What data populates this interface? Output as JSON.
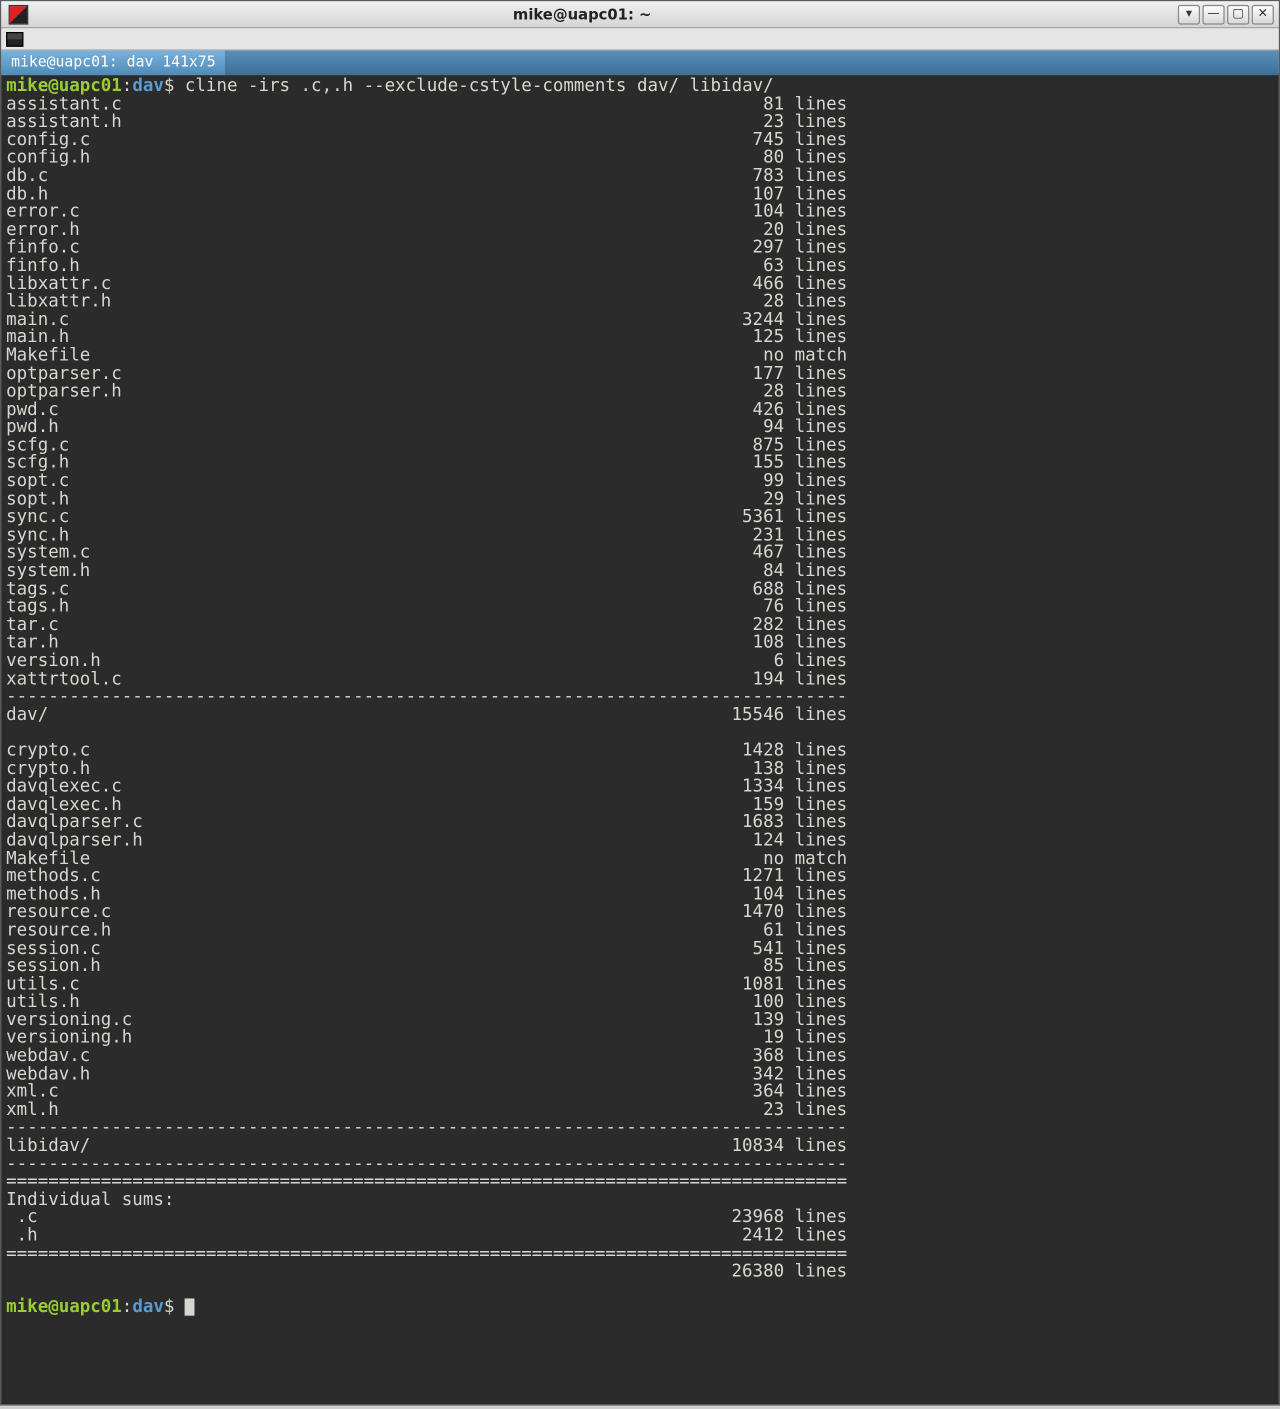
{
  "titlebar": {
    "title": "mike@uapc01: ~"
  },
  "wm": {
    "stick": "▾",
    "min": "—",
    "max": "▢",
    "close": "✕"
  },
  "tab": {
    "label": "mike@uapc01: dav 141x75"
  },
  "prompt": {
    "user": "mike@uapc01",
    "sep": ":",
    "path": "dav",
    "dollar": "$"
  },
  "command": "cline -irs .c,.h --exclude-cstyle-comments dav/ libidav/",
  "lines_word": "lines",
  "no_match": "no match",
  "group1": [
    {
      "name": "assistant.c",
      "val": "81"
    },
    {
      "name": "assistant.h",
      "val": "23"
    },
    {
      "name": "config.c",
      "val": "745"
    },
    {
      "name": "config.h",
      "val": "80"
    },
    {
      "name": "db.c",
      "val": "783"
    },
    {
      "name": "db.h",
      "val": "107"
    },
    {
      "name": "error.c",
      "val": "104"
    },
    {
      "name": "error.h",
      "val": "20"
    },
    {
      "name": "finfo.c",
      "val": "297"
    },
    {
      "name": "finfo.h",
      "val": "63"
    },
    {
      "name": "libxattr.c",
      "val": "466"
    },
    {
      "name": "libxattr.h",
      "val": "28"
    },
    {
      "name": "main.c",
      "val": "3244"
    },
    {
      "name": "main.h",
      "val": "125"
    },
    {
      "name": "Makefile",
      "val": "",
      "nomatch": true
    },
    {
      "name": "optparser.c",
      "val": "177"
    },
    {
      "name": "optparser.h",
      "val": "28"
    },
    {
      "name": "pwd.c",
      "val": "426"
    },
    {
      "name": "pwd.h",
      "val": "94"
    },
    {
      "name": "scfg.c",
      "val": "875"
    },
    {
      "name": "scfg.h",
      "val": "155"
    },
    {
      "name": "sopt.c",
      "val": "99"
    },
    {
      "name": "sopt.h",
      "val": "29"
    },
    {
      "name": "sync.c",
      "val": "5361"
    },
    {
      "name": "sync.h",
      "val": "231"
    },
    {
      "name": "system.c",
      "val": "467"
    },
    {
      "name": "system.h",
      "val": "84"
    },
    {
      "name": "tags.c",
      "val": "688"
    },
    {
      "name": "tags.h",
      "val": "76"
    },
    {
      "name": "tar.c",
      "val": "282"
    },
    {
      "name": "tar.h",
      "val": "108"
    },
    {
      "name": "version.h",
      "val": "6"
    },
    {
      "name": "xattrtool.c",
      "val": "194"
    }
  ],
  "group1_total": {
    "name": "dav/",
    "val": "15546"
  },
  "group2": [
    {
      "name": "crypto.c",
      "val": "1428"
    },
    {
      "name": "crypto.h",
      "val": "138"
    },
    {
      "name": "davqlexec.c",
      "val": "1334"
    },
    {
      "name": "davqlexec.h",
      "val": "159"
    },
    {
      "name": "davqlparser.c",
      "val": "1683"
    },
    {
      "name": "davqlparser.h",
      "val": "124"
    },
    {
      "name": "Makefile",
      "val": "",
      "nomatch": true
    },
    {
      "name": "methods.c",
      "val": "1271"
    },
    {
      "name": "methods.h",
      "val": "104"
    },
    {
      "name": "resource.c",
      "val": "1470"
    },
    {
      "name": "resource.h",
      "val": "61"
    },
    {
      "name": "session.c",
      "val": "541"
    },
    {
      "name": "session.h",
      "val": "85"
    },
    {
      "name": "utils.c",
      "val": "1081"
    },
    {
      "name": "utils.h",
      "val": "100"
    },
    {
      "name": "versioning.c",
      "val": "139"
    },
    {
      "name": "versioning.h",
      "val": "19"
    },
    {
      "name": "webdav.c",
      "val": "368"
    },
    {
      "name": "webdav.h",
      "val": "342"
    },
    {
      "name": "xml.c",
      "val": "364"
    },
    {
      "name": "xml.h",
      "val": "23"
    }
  ],
  "group2_total": {
    "name": "libidav/",
    "val": "10834"
  },
  "individual_label": "Individual sums:",
  "sums": [
    {
      "name": " .c",
      "val": "23968"
    },
    {
      "name": " .h",
      "val": "2412"
    }
  ],
  "grand_total": {
    "name": "",
    "val": "26380"
  }
}
